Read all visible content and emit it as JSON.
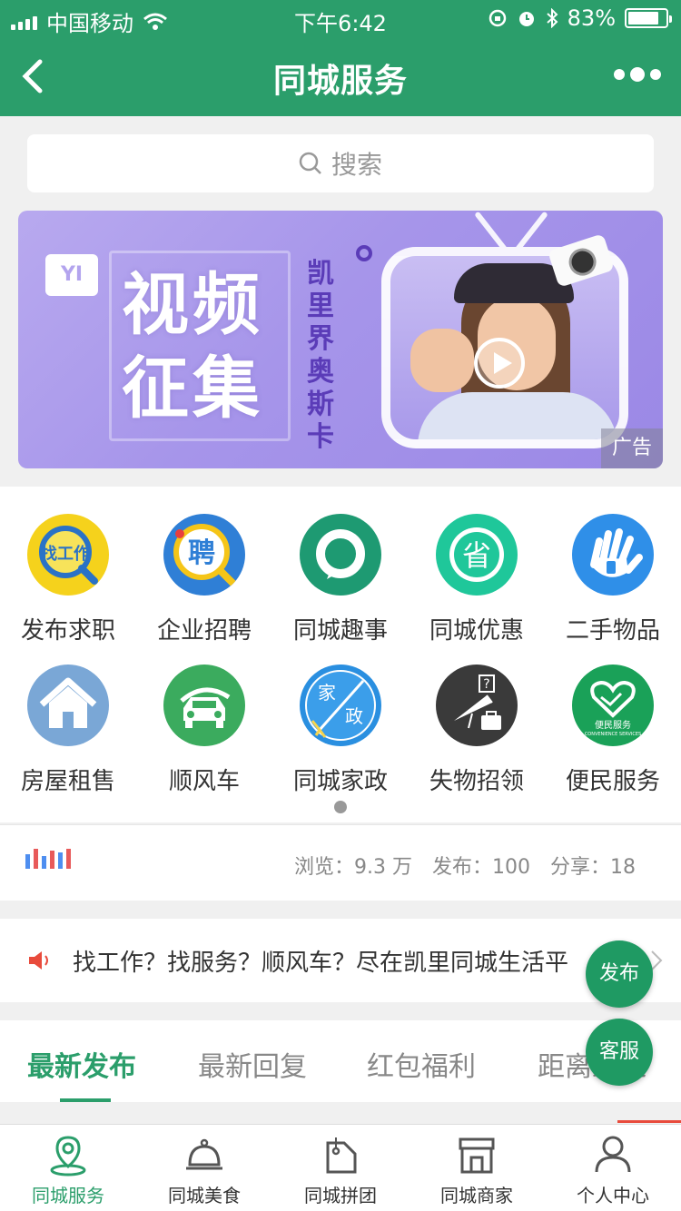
{
  "status_bar": {
    "carrier": "中国移动",
    "time": "下午6:42",
    "battery": "83%",
    "battery_level": 0.83
  },
  "nav": {
    "title": "同城服务"
  },
  "search": {
    "placeholder": "搜索"
  },
  "banner": {
    "brand": "YI",
    "headline_line1": "视频",
    "headline_line2": "征集",
    "vertical_text": "凯里界奥斯卡",
    "ad_label": "广告"
  },
  "grid": {
    "items": [
      {
        "label": "发布求职",
        "icon": "find-job-icon",
        "color": "#f5d21c"
      },
      {
        "label": "企业招聘",
        "icon": "recruit-icon",
        "color": "#2f7fd6"
      },
      {
        "label": "同城趣事",
        "icon": "chat-bubble-icon",
        "color": "#1e9a72"
      },
      {
        "label": "同城优惠",
        "icon": "save-icon",
        "color": "#1fc79a"
      },
      {
        "label": "二手物品",
        "icon": "hand-icon",
        "color": "#2f8fe8"
      },
      {
        "label": "房屋租售",
        "icon": "house-icon",
        "color": "#7aa7d6"
      },
      {
        "label": "顺风车",
        "icon": "car-icon",
        "color": "#3bab5e"
      },
      {
        "label": "同城家政",
        "icon": "housekeeping-icon",
        "color": "#2a8fe0"
      },
      {
        "label": "失物招领",
        "icon": "lost-found-icon",
        "color": "#3a3a3a"
      },
      {
        "label": "便民服务",
        "icon": "convenience-icon",
        "color": "#1aa158"
      }
    ],
    "housekeeping_char1": "家",
    "housekeeping_char2": "政",
    "find_job_chars": "找工作",
    "recruit_char": "聘",
    "save_char": "省",
    "convenience_text": "便民服务",
    "convenience_subtext": "CONVENIENCE SERVICES"
  },
  "stats": {
    "views": "浏览：9.3 万",
    "posts": "发布：100",
    "shares": "分享：18"
  },
  "notice": {
    "text": "找工作？找服务？顺风车？尽在凯里同城生活平"
  },
  "tabs": [
    {
      "label": "最新发布",
      "active": true
    },
    {
      "label": "最新回复",
      "active": false
    },
    {
      "label": "红包福利",
      "active": false
    },
    {
      "label": "距离最近",
      "active": false
    }
  ],
  "floating": {
    "post": "发布",
    "service": "客服"
  },
  "tabbar": [
    {
      "label": "同城服务",
      "icon": "location-icon",
      "active": true
    },
    {
      "label": "同城美食",
      "icon": "food-cloche-icon",
      "active": false
    },
    {
      "label": "同城拼团",
      "icon": "tag-icon",
      "active": false
    },
    {
      "label": "同城商家",
      "icon": "store-icon",
      "active": false
    },
    {
      "label": "个人中心",
      "icon": "user-icon",
      "active": false
    }
  ],
  "colors": {
    "brand_green": "#2b9e6b",
    "fab_green": "#1f9a63"
  }
}
